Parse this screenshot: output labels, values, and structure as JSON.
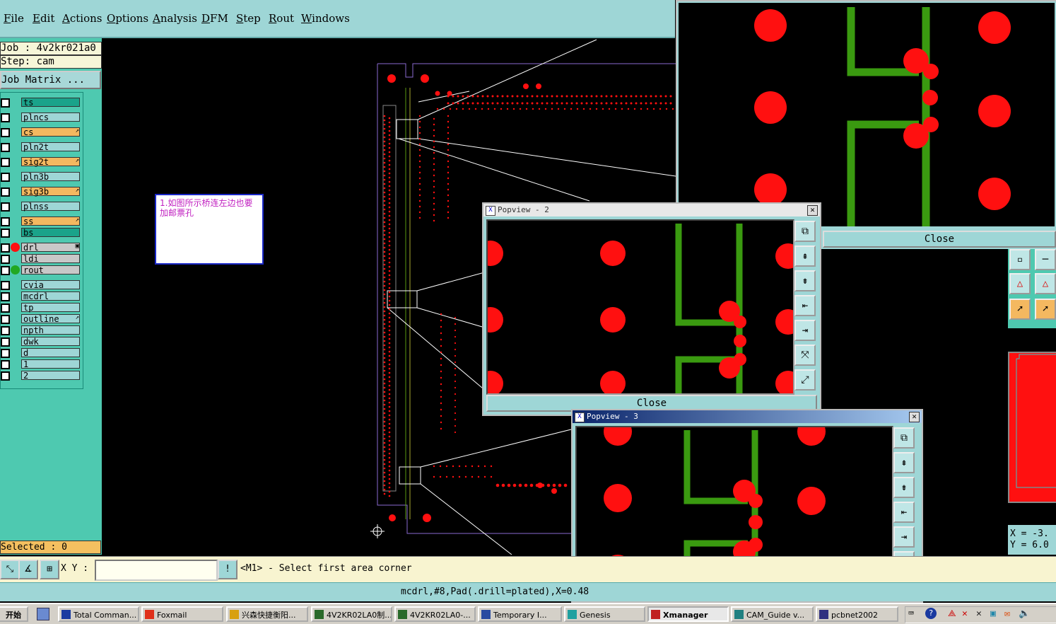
{
  "menu": {
    "items": [
      "File",
      "Edit",
      "Actions",
      "Options",
      "Analysis",
      "DFM",
      "Step",
      "Rout",
      "Windows"
    ]
  },
  "job": {
    "job_line": "Job : 4v2kr021a0",
    "step_line": "Step: cam",
    "matrix_button": "Job Matrix ..."
  },
  "layers": [
    {
      "name": "ts",
      "color": "#1aa38a",
      "marker": ""
    },
    {
      "name": "plncs",
      "color": "#9ed6d6",
      "marker": ""
    },
    {
      "name": "cs",
      "color": "#f4b860",
      "marker": "↗"
    },
    {
      "name": "pln2t",
      "color": "#9ed6d6",
      "marker": ""
    },
    {
      "name": "sig2t",
      "color": "#f4b860",
      "marker": "↗"
    },
    {
      "name": "pln3b",
      "color": "#9ed6d6",
      "marker": ""
    },
    {
      "name": "sig3b",
      "color": "#f4b860",
      "marker": "↗"
    },
    {
      "name": "plnss",
      "color": "#9ed6d6",
      "marker": ""
    },
    {
      "name": "ss",
      "color": "#f4b860",
      "marker": "↗"
    },
    {
      "name": "bs",
      "color": "#1aa38a",
      "marker": ""
    },
    {
      "name": "drl",
      "color": "#c8c8c8",
      "marker": "▣",
      "dot": "#ff1010"
    },
    {
      "name": "ldi",
      "color": "#c8c8c8",
      "marker": ""
    },
    {
      "name": "rout",
      "color": "#c8c8c8",
      "marker": "",
      "dot": "#22a822"
    },
    {
      "name": "cvia",
      "color": "#9ed6d6",
      "marker": ""
    },
    {
      "name": "mcdrl",
      "color": "#9ed6d6",
      "marker": ""
    },
    {
      "name": "tp",
      "color": "#9ed6d6",
      "marker": ""
    },
    {
      "name": "outline",
      "color": "#9ed6d6",
      "marker": "↗"
    },
    {
      "name": "npth",
      "color": "#9ed6d6",
      "marker": ""
    },
    {
      "name": "dwk",
      "color": "#9ed6d6",
      "marker": ""
    },
    {
      "name": "d",
      "color": "#9ed6d6",
      "marker": ""
    },
    {
      "name": "1",
      "color": "#9ed6d6",
      "marker": ""
    },
    {
      "name": "2",
      "color": "#9ed6d6",
      "marker": ""
    }
  ],
  "selected": "Selected : 0",
  "note": "1.如图所示桥连左边也要加邮票孔",
  "command": {
    "xy_label": "X Y :",
    "xy_value": "",
    "prompt": "<M1> - Select first area corner"
  },
  "status_line": "mcdrl,#8,Pad(.drill=plated),X=0.48",
  "popview2": {
    "title": "Popview - 2",
    "close": "Close"
  },
  "popview3": {
    "title": "Popview - 3"
  },
  "popview1": {
    "close": "Close"
  },
  "coords": {
    "x": "X = -3.",
    "y": "Y = 6.0"
  },
  "taskbar": {
    "start": "开始",
    "tasks": [
      "Total Comman...",
      "Foxmail",
      "兴森快捷衡阳...",
      "4V2KR02LA0制...",
      "4V2KR02LA0-...",
      "Temporary I...",
      "Genesis",
      "Xmanager",
      "CAM_Guide v...",
      "pcbnet2002"
    ]
  },
  "colors": {
    "pad": "#ff1010",
    "trace": "#2e9a10",
    "panel": "#9ed6d6",
    "layer_panel": "#4ec9b0"
  }
}
